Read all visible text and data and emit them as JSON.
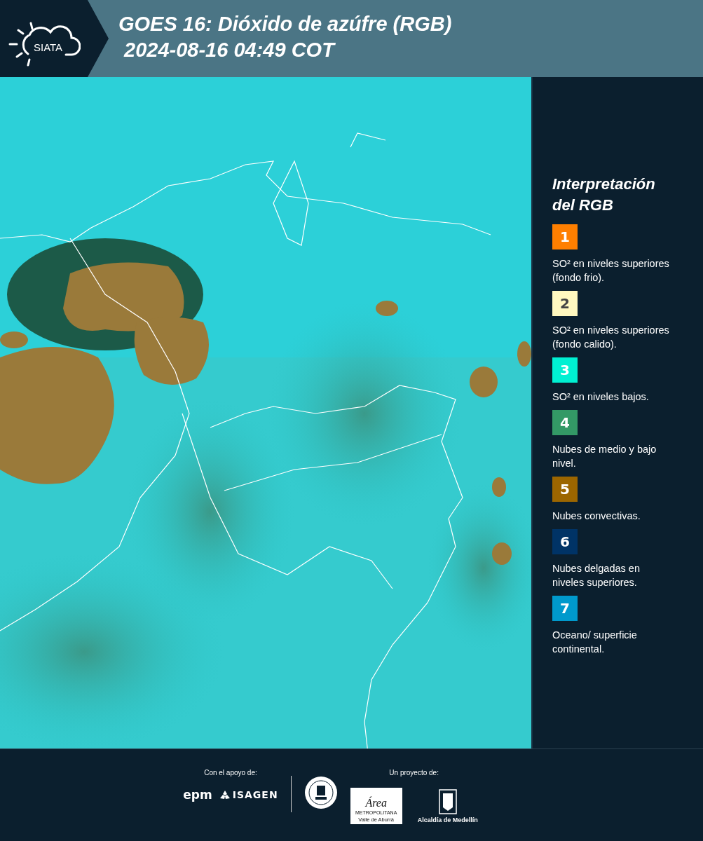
{
  "header": {
    "logo_text": "SIATA",
    "title": "GOES 16: Dióxido de azúfre (RGB)",
    "timestamp": "2024-08-16 04:49 COT"
  },
  "legend": {
    "title_lines": [
      "Interpretación",
      "del RGB"
    ],
    "items": [
      {
        "number": "1",
        "color": "#ff7f00",
        "text": "SO² en niveles superiores (fondo frio)."
      },
      {
        "number": "2",
        "color": "#fff8c0",
        "text": "SO² en niveles superiores (fondo calido)."
      },
      {
        "number": "3",
        "color": "#00f0d2",
        "text": "SO² en niveles bajos."
      },
      {
        "number": "4",
        "color": "#339966",
        "text": "Nubes de medio y bajo nivel."
      },
      {
        "number": "5",
        "color": "#9c6600",
        "text": "Nubes convectivas."
      },
      {
        "number": "6",
        "color": "#003366",
        "text": "Nubes delgadas en niveles superiores."
      },
      {
        "number": "7",
        "color": "#0099cc",
        "text": "Oceano/ superficie continental."
      }
    ]
  },
  "footer": {
    "support_label": "Con el apoyo de:",
    "support_logos": [
      "epm",
      "ISAGEN"
    ],
    "project_label": "Un proyecto de:",
    "area_logo": {
      "name": "Área",
      "line1": "METROPOLITANA",
      "line2": "Valle de Aburrá"
    },
    "alcaldia_logo": "Alcaldía de Medellín"
  }
}
